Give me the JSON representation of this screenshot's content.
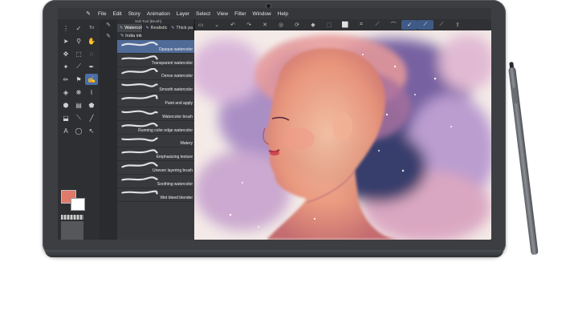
{
  "menu": {
    "items": [
      "File",
      "Edit",
      "Story",
      "Animation",
      "Layer",
      "Select",
      "View",
      "Filter",
      "Window",
      "Help"
    ]
  },
  "toolbar": {
    "icons": [
      "canvas-icon",
      "chevron-down-icon",
      "undo-icon",
      "redo-icon",
      "clear-icon",
      "transform-icon",
      "rotate-icon",
      "fill-icon",
      "select-icon",
      "deselect-icon",
      "crop-icon",
      "pen-stroke-icon",
      "smooth-stroke-icon",
      "ruler-stroke-icon",
      "share-icon"
    ]
  },
  "tools": {
    "label": "Tri",
    "items": [
      "grip",
      "tool-tab",
      "brush-small",
      "pointer",
      "zoom",
      "hand",
      "move",
      "select-rect",
      "lasso-select",
      "wand",
      "eyedropper",
      "pen",
      "pencil",
      "brush",
      "airbrush",
      "decorate",
      "eraser",
      "fill",
      "gradient",
      "figure",
      "frame",
      "ruler",
      "text",
      "balloon",
      "correction"
    ],
    "main_color": "#e07a6a",
    "sub_color": "#ffffff"
  },
  "brush_panel": {
    "title": "Sub Tool [Brush]",
    "tabs": [
      "Watercol",
      "Realistic",
      "Thick pa"
    ],
    "ink_label": "India ink",
    "selected_index": 0,
    "brushes": [
      "Opaque watercolor",
      "Transparent watercolor",
      "Dense watercolor",
      "Smooth watercolor",
      "Paint and apply",
      "Watercolor brush",
      "Running color edge watercolor",
      "Watery",
      "Emphasizing texture",
      "Uneven layering brush",
      "Soothing watercolor",
      "Wet bleed blender"
    ]
  },
  "colors": {
    "selection": "#506b98",
    "accent": "#4b6ea8",
    "panel_bg": "#38393c"
  }
}
